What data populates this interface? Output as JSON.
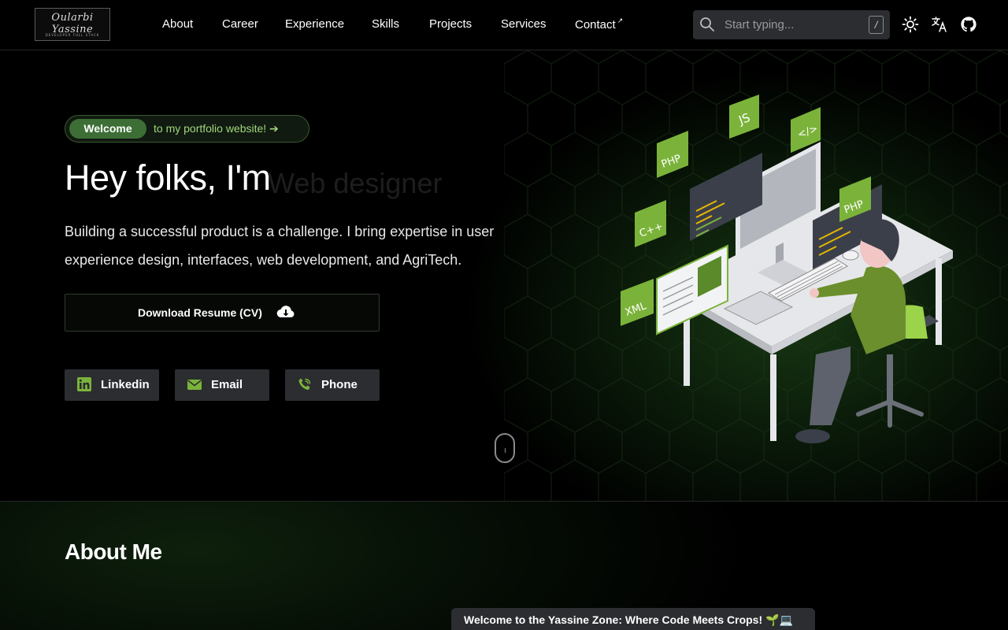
{
  "nav": {
    "logo_text": "Oularbi Yassine",
    "logo_subtitle": "DEVELOPER FULL STACK",
    "links": [
      {
        "label": "About"
      },
      {
        "label": "Career"
      },
      {
        "label": "Experience"
      },
      {
        "label": "Skills"
      },
      {
        "label": "Projects"
      },
      {
        "label": "Services"
      },
      {
        "label": "Contact",
        "external": true
      }
    ],
    "search": {
      "placeholder": "Start typing...",
      "shortcut": "/"
    },
    "icons": [
      "theme-toggle-sun-icon",
      "translate-icon",
      "github-icon"
    ]
  },
  "hero": {
    "pill_tag": "Welcome",
    "pill_text": "to my portfolio website! ➔",
    "title": "Hey folks, I'm",
    "role": "Web designer",
    "description": "Building a successful product is a challenge. I bring expertise in user experience design, interfaces, web development, and AgriTech.",
    "resume_button": "Download Resume (CV)",
    "socials": [
      {
        "label": "Linkedin",
        "icon": "linkedin-icon"
      },
      {
        "label": "Email",
        "icon": "email-icon"
      },
      {
        "label": "Phone",
        "icon": "phone-icon"
      }
    ],
    "illustration_tags": [
      "JS",
      "</>",
      "PHP",
      "PHP",
      "C++",
      "XML"
    ]
  },
  "about": {
    "title": "About Me"
  },
  "toast": {
    "text": "Welcome to the Yassine Zone: Where Code Meets Crops! 🌱💻"
  },
  "colors": {
    "accent_green": "#7bb33a",
    "pill_green": "#3c6e35",
    "surface": "#2b2d31"
  }
}
